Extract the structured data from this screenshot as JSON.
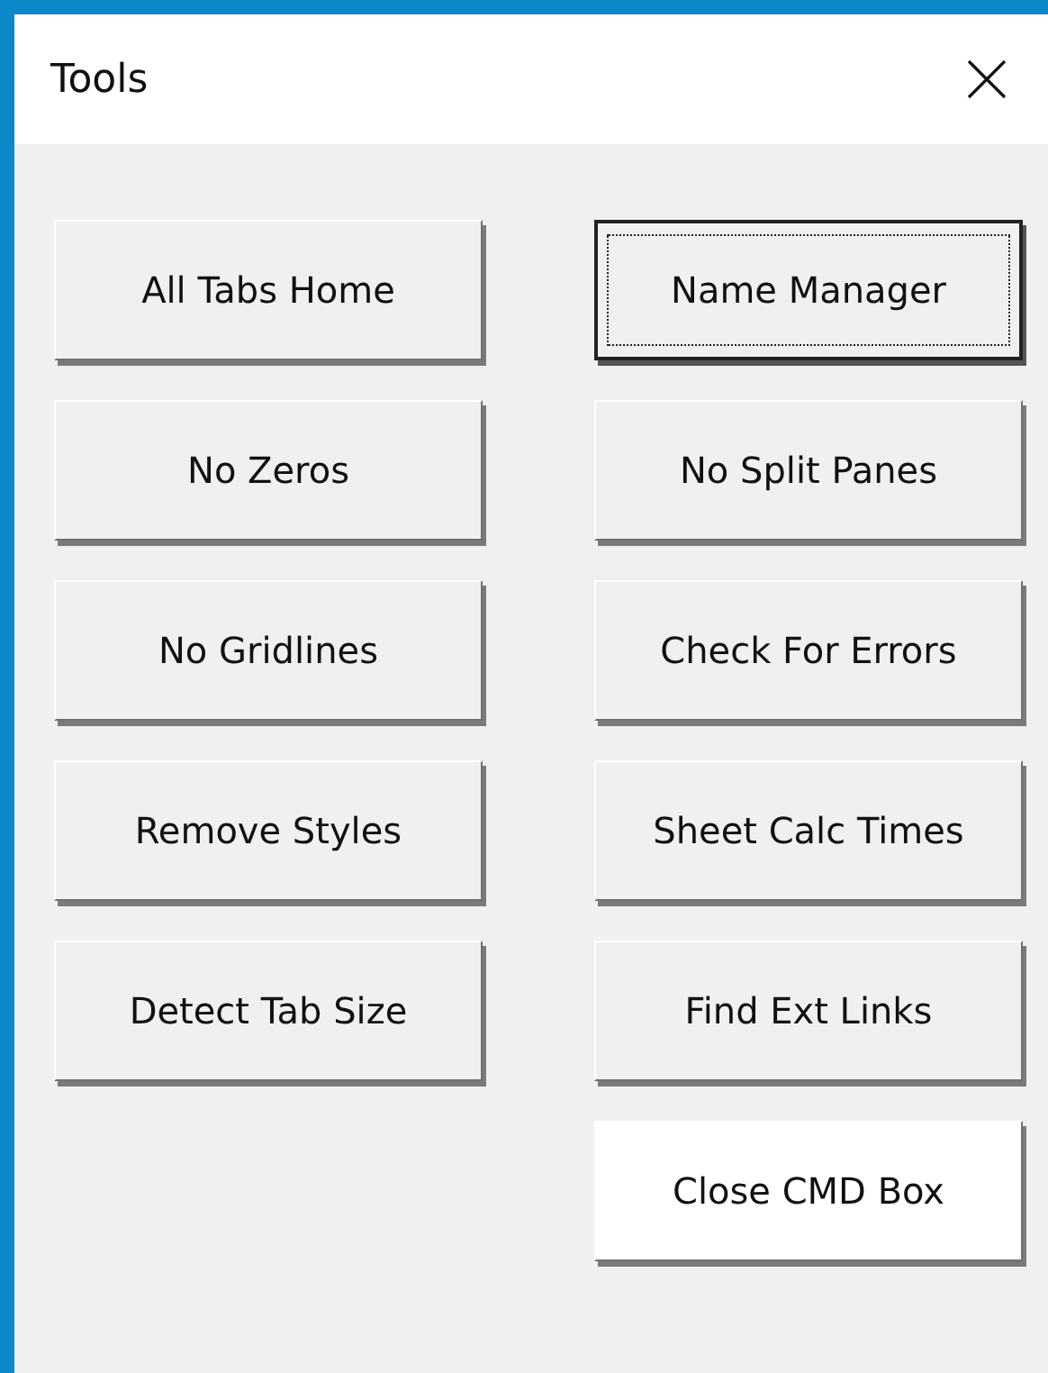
{
  "window": {
    "title": "Tools"
  },
  "columns": [
    {
      "buttons": [
        {
          "label": "All Tabs Home",
          "focused": false,
          "kind": "normal"
        },
        {
          "label": "No Zeros",
          "focused": false,
          "kind": "normal"
        },
        {
          "label": "No Gridlines",
          "focused": false,
          "kind": "normal"
        },
        {
          "label": "Remove Styles",
          "focused": false,
          "kind": "normal"
        },
        {
          "label": "Detect Tab Size",
          "focused": false,
          "kind": "normal"
        }
      ]
    },
    {
      "buttons": [
        {
          "label": "Name Manager",
          "focused": true,
          "kind": "normal"
        },
        {
          "label": "No Split Panes",
          "focused": false,
          "kind": "normal"
        },
        {
          "label": "Check For Errors",
          "focused": false,
          "kind": "normal"
        },
        {
          "label": "Sheet Calc Times",
          "focused": false,
          "kind": "normal"
        },
        {
          "label": "Find Ext Links",
          "focused": false,
          "kind": "normal"
        },
        {
          "label": "Close CMD Box",
          "focused": false,
          "kind": "cancel"
        }
      ]
    }
  ]
}
